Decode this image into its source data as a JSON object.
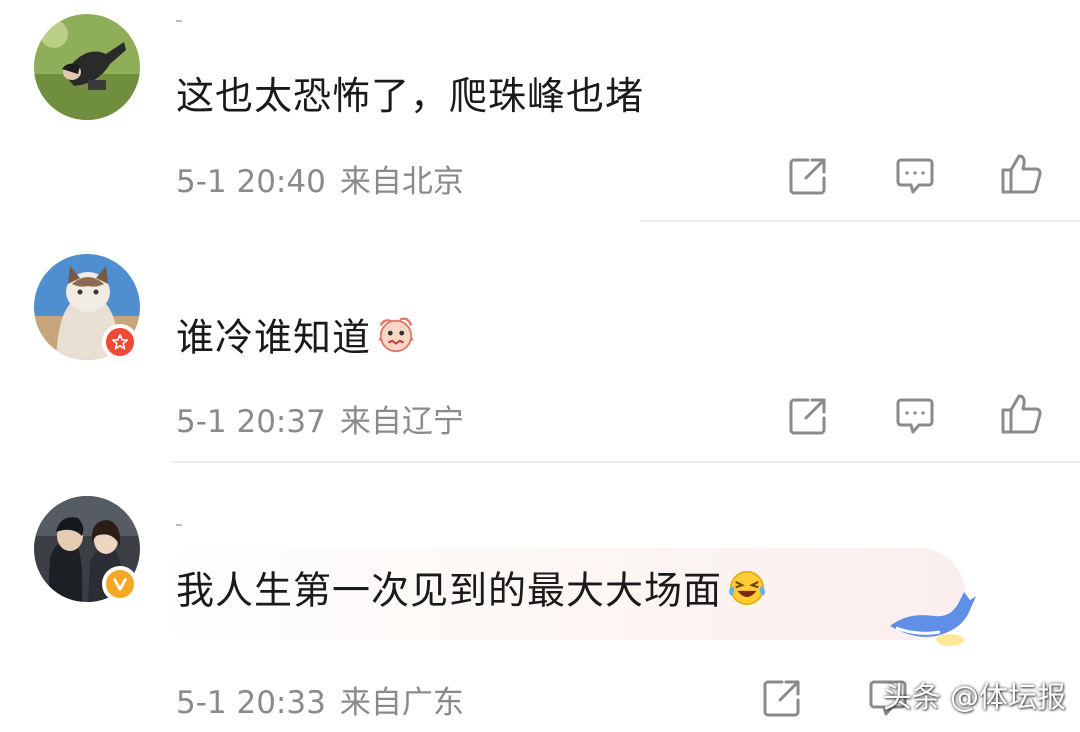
{
  "comments": [
    {
      "text": "这也太恐怖了，爬珠峰也堵",
      "time": "5-1 20:40",
      "location": "来自北京",
      "badge": null
    },
    {
      "text": "谁冷谁知道",
      "time": "5-1 20:37",
      "location": "来自辽宁",
      "badge": "red-star"
    },
    {
      "text": "我人生第一次见到的最大大场面",
      "time": "5-1 20:33",
      "location": "来自广东",
      "badge": "gold-v"
    }
  ],
  "icons": {
    "share": "share-icon",
    "reply": "comment-icon",
    "like": "like-icon"
  },
  "watermark": "头条 @体坛报",
  "colors": {
    "meta": "#8a8a8a",
    "icon": "#8a8a8a",
    "badge_red": "#f04a36",
    "badge_gold": "#f5a623"
  }
}
